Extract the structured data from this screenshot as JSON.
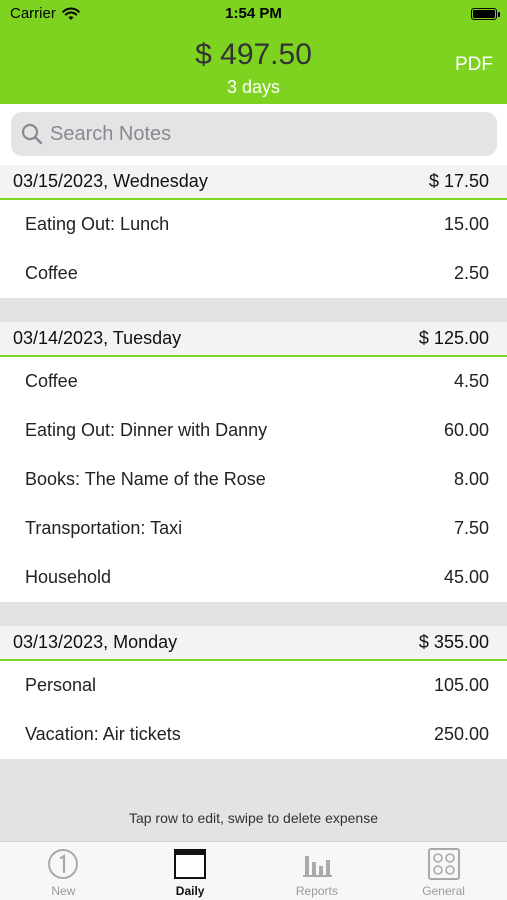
{
  "status_bar": {
    "carrier": "Carrier",
    "time": "1:54 PM"
  },
  "header": {
    "total": "$ 497.50",
    "days": "3 days",
    "pdf_label": "PDF"
  },
  "search": {
    "placeholder": "Search Notes"
  },
  "sections": [
    {
      "date": "03/15/2023, Wednesday",
      "total": "$  17.50",
      "items": [
        {
          "label": "Eating Out: Lunch",
          "amount": "15.00"
        },
        {
          "label": "Coffee",
          "amount": "2.50"
        }
      ]
    },
    {
      "date": "03/14/2023, Tuesday",
      "total": "$  125.00",
      "items": [
        {
          "label": "Coffee",
          "amount": "4.50"
        },
        {
          "label": "Eating Out: Dinner with Danny",
          "amount": "60.00"
        },
        {
          "label": "Books: The Name of the Rose",
          "amount": "8.00"
        },
        {
          "label": "Transportation: Taxi",
          "amount": "7.50"
        },
        {
          "label": "Household",
          "amount": "45.00"
        }
      ]
    },
    {
      "date": "03/13/2023, Monday",
      "total": "$  355.00",
      "items": [
        {
          "label": "Personal",
          "amount": "105.00"
        },
        {
          "label": "Vacation: Air tickets",
          "amount": "250.00"
        }
      ]
    }
  ],
  "hint": "Tap row to edit, swipe to delete expense",
  "tabs": [
    {
      "label": "New",
      "icon": "circled-one-icon"
    },
    {
      "label": "Daily",
      "icon": "calendar-page-icon"
    },
    {
      "label": "Reports",
      "icon": "bar-chart-icon"
    },
    {
      "label": "General",
      "icon": "settings-grid-icon"
    }
  ],
  "colors": {
    "accent": "#7ed321",
    "background": "#e3e3e3"
  }
}
